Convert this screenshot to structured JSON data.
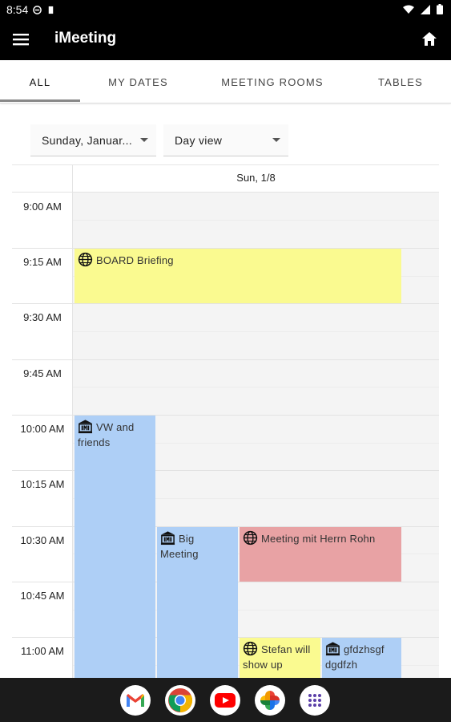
{
  "status_bar": {
    "time": "8:54"
  },
  "app_bar": {
    "title": "iMeeting"
  },
  "tabs": [
    {
      "label": "ALL",
      "active": true
    },
    {
      "label": "MY DATES",
      "active": false
    },
    {
      "label": "MEETING ROOMS",
      "active": false
    },
    {
      "label": "TABLES",
      "active": false
    }
  ],
  "filters": {
    "date_select": "Sunday, Januar...",
    "view_select": "Day view"
  },
  "calendar": {
    "day_header": "Sun, 1/8",
    "times": [
      "9:00 AM",
      "9:15 AM",
      "9:30 AM",
      "9:45 AM",
      "10:00 AM",
      "10:15 AM",
      "10:30 AM",
      "10:45 AM",
      "11:00 AM"
    ],
    "events": [
      {
        "title": "BOARD Briefing",
        "icon": "globe-icon",
        "color": "#fafa90"
      },
      {
        "title": "VW and friends",
        "icon": "building-icon",
        "color": "#aecff6"
      },
      {
        "title": "Big Meeting",
        "icon": "building-icon",
        "color": "#aecff6"
      },
      {
        "title": "Meeting mit Herrn Rohn",
        "icon": "globe-icon",
        "color": "#e8a2a4"
      },
      {
        "title": "Stefan will show up",
        "icon": "globe-icon",
        "color": "#fafa90"
      },
      {
        "title": "gfdzhsgf dgdfzh",
        "icon": "building-icon",
        "color": "#aecff6"
      }
    ]
  },
  "dock": [
    "gmail-icon",
    "chrome-icon",
    "youtube-icon",
    "photos-icon",
    "apps-icon"
  ]
}
